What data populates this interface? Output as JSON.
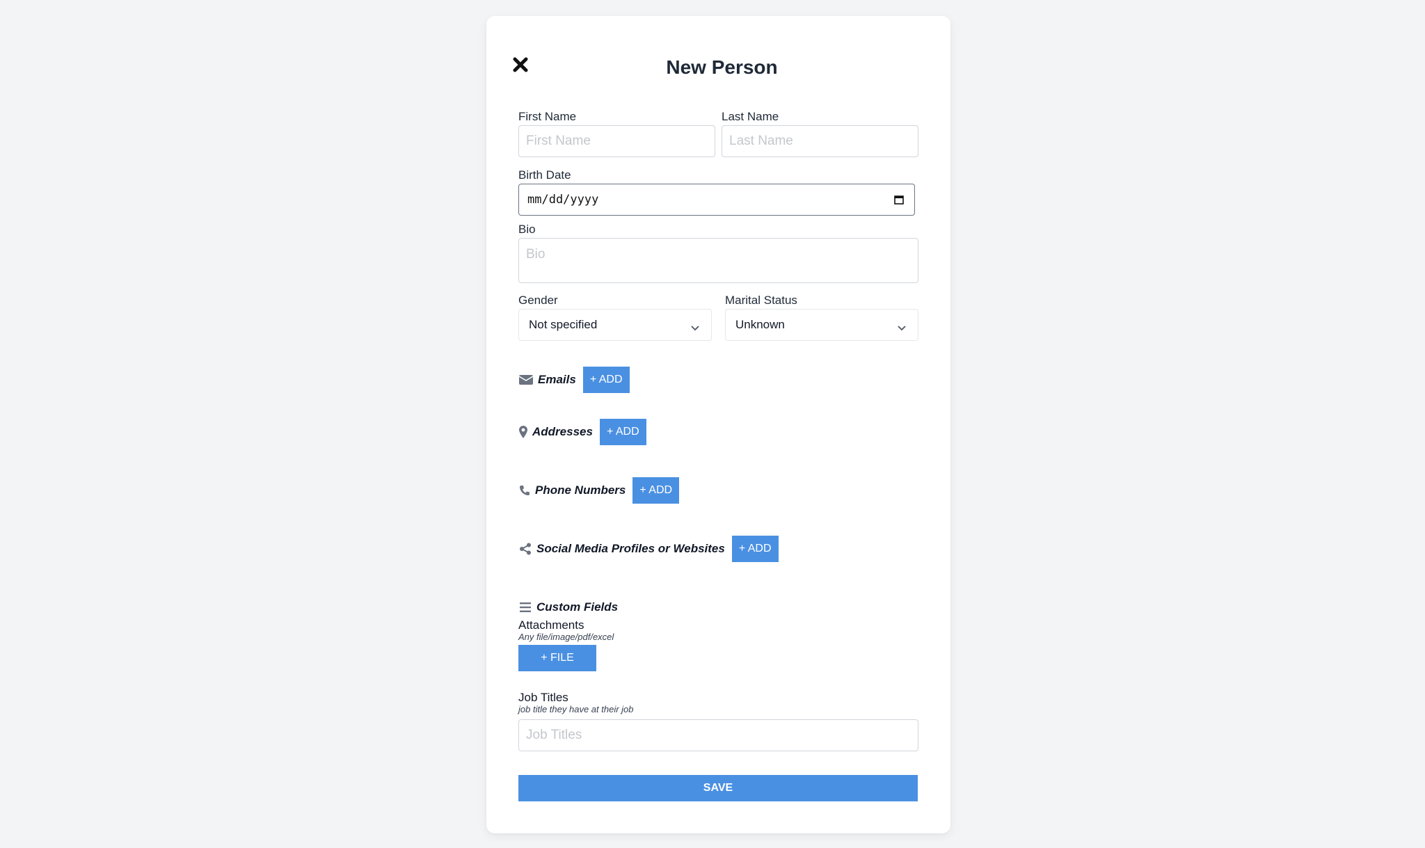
{
  "modal": {
    "title": "New Person"
  },
  "fields": {
    "first_name": {
      "label": "First Name",
      "placeholder": "First Name",
      "value": ""
    },
    "last_name": {
      "label": "Last Name",
      "placeholder": "Last Name",
      "value": ""
    },
    "birth_date": {
      "label": "Birth Date",
      "value": "mm/dd/yyyy"
    },
    "bio": {
      "label": "Bio",
      "placeholder": "Bio",
      "value": ""
    },
    "gender": {
      "label": "Gender",
      "selected": "Not specified"
    },
    "marital_status": {
      "label": "Marital Status",
      "selected": "Unknown"
    }
  },
  "sections": {
    "emails": {
      "label": "Emails",
      "icon": "envelope-icon",
      "add_label": "+ ADD"
    },
    "addresses": {
      "label": "Addresses",
      "icon": "map-pin-icon",
      "add_label": "+ ADD"
    },
    "phones": {
      "label": "Phone Numbers",
      "icon": "phone-icon",
      "add_label": "+ ADD"
    },
    "social": {
      "label": "Social Media Profiles or Websites",
      "icon": "share-icon",
      "add_label": "+ ADD"
    },
    "custom": {
      "label": "Custom Fields",
      "icon": "list-icon"
    }
  },
  "custom_fields": {
    "attachments": {
      "label": "Attachments",
      "hint": "Any file/image/pdf/excel",
      "button_label": "+ FILE"
    },
    "job_titles": {
      "label": "Job Titles",
      "hint": "job title they have at their job",
      "placeholder": "Job Titles",
      "value": ""
    }
  },
  "actions": {
    "save_label": "SAVE"
  },
  "colors": {
    "background": "#f3f4f6",
    "primary": "#4a90e2",
    "card": "#ffffff"
  }
}
